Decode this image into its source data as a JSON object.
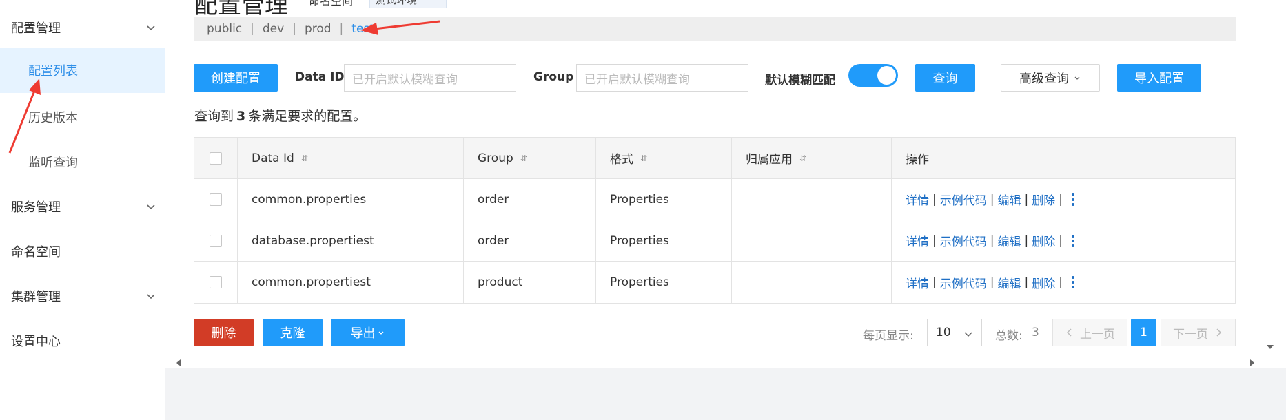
{
  "header": {
    "title_fragment": "配置管理",
    "sub_fragment": "命名空间",
    "env_fragment": "测试环境"
  },
  "sidebar": {
    "items": [
      {
        "label": "配置管理",
        "type": "group",
        "expanded": true
      },
      {
        "label": "配置列表",
        "type": "sub",
        "active": true
      },
      {
        "label": "历史版本",
        "type": "sub"
      },
      {
        "label": "监听查询",
        "type": "sub"
      },
      {
        "label": "服务管理",
        "type": "group"
      },
      {
        "label": "命名空间",
        "type": "plain"
      },
      {
        "label": "集群管理",
        "type": "group"
      },
      {
        "label": "设置中心",
        "type": "plain"
      }
    ]
  },
  "namespaces": {
    "items": [
      "public",
      "dev",
      "prod",
      "test"
    ],
    "separator": "|",
    "active": "test"
  },
  "toolbar": {
    "create_label": "创建配置",
    "dataid_label": "Data ID",
    "dataid_placeholder": "已开启默认模糊查询",
    "group_label": "Group",
    "group_placeholder": "已开启默认模糊查询",
    "fuzzy_label": "默认模糊匹配",
    "fuzzy_on": true,
    "query_label": "查询",
    "advanced_label": "高级查询",
    "import_label": "导入配置"
  },
  "result": {
    "prefix": "查询到",
    "count": "3",
    "suffix": "条满足要求的配置。"
  },
  "table": {
    "columns": [
      "Data Id",
      "Group",
      "格式",
      "归属应用",
      "操作"
    ],
    "rows": [
      {
        "data_id": "common.properties",
        "group": "order",
        "format": "Properties",
        "app": ""
      },
      {
        "data_id": "database.propertiest",
        "group": "order",
        "format": "Properties",
        "app": ""
      },
      {
        "data_id": "common.propertiest",
        "group": "product",
        "format": "Properties",
        "app": ""
      }
    ],
    "actions": [
      "详情",
      "示例代码",
      "编辑",
      "删除"
    ],
    "action_sep": "|"
  },
  "footer": {
    "delete_label": "删除",
    "clone_label": "克隆",
    "export_label": "导出"
  },
  "pager": {
    "per_page_label": "每页显示:",
    "per_page_value": "10",
    "total_label": "总数:",
    "total_value": "3",
    "prev_label": "上一页",
    "page": "1",
    "next_label": "下一页"
  },
  "colors": {
    "primary": "#209bfa",
    "danger": "#d23c26",
    "link": "#1f6fc5",
    "annotation_arrow": "#ee3b32"
  }
}
